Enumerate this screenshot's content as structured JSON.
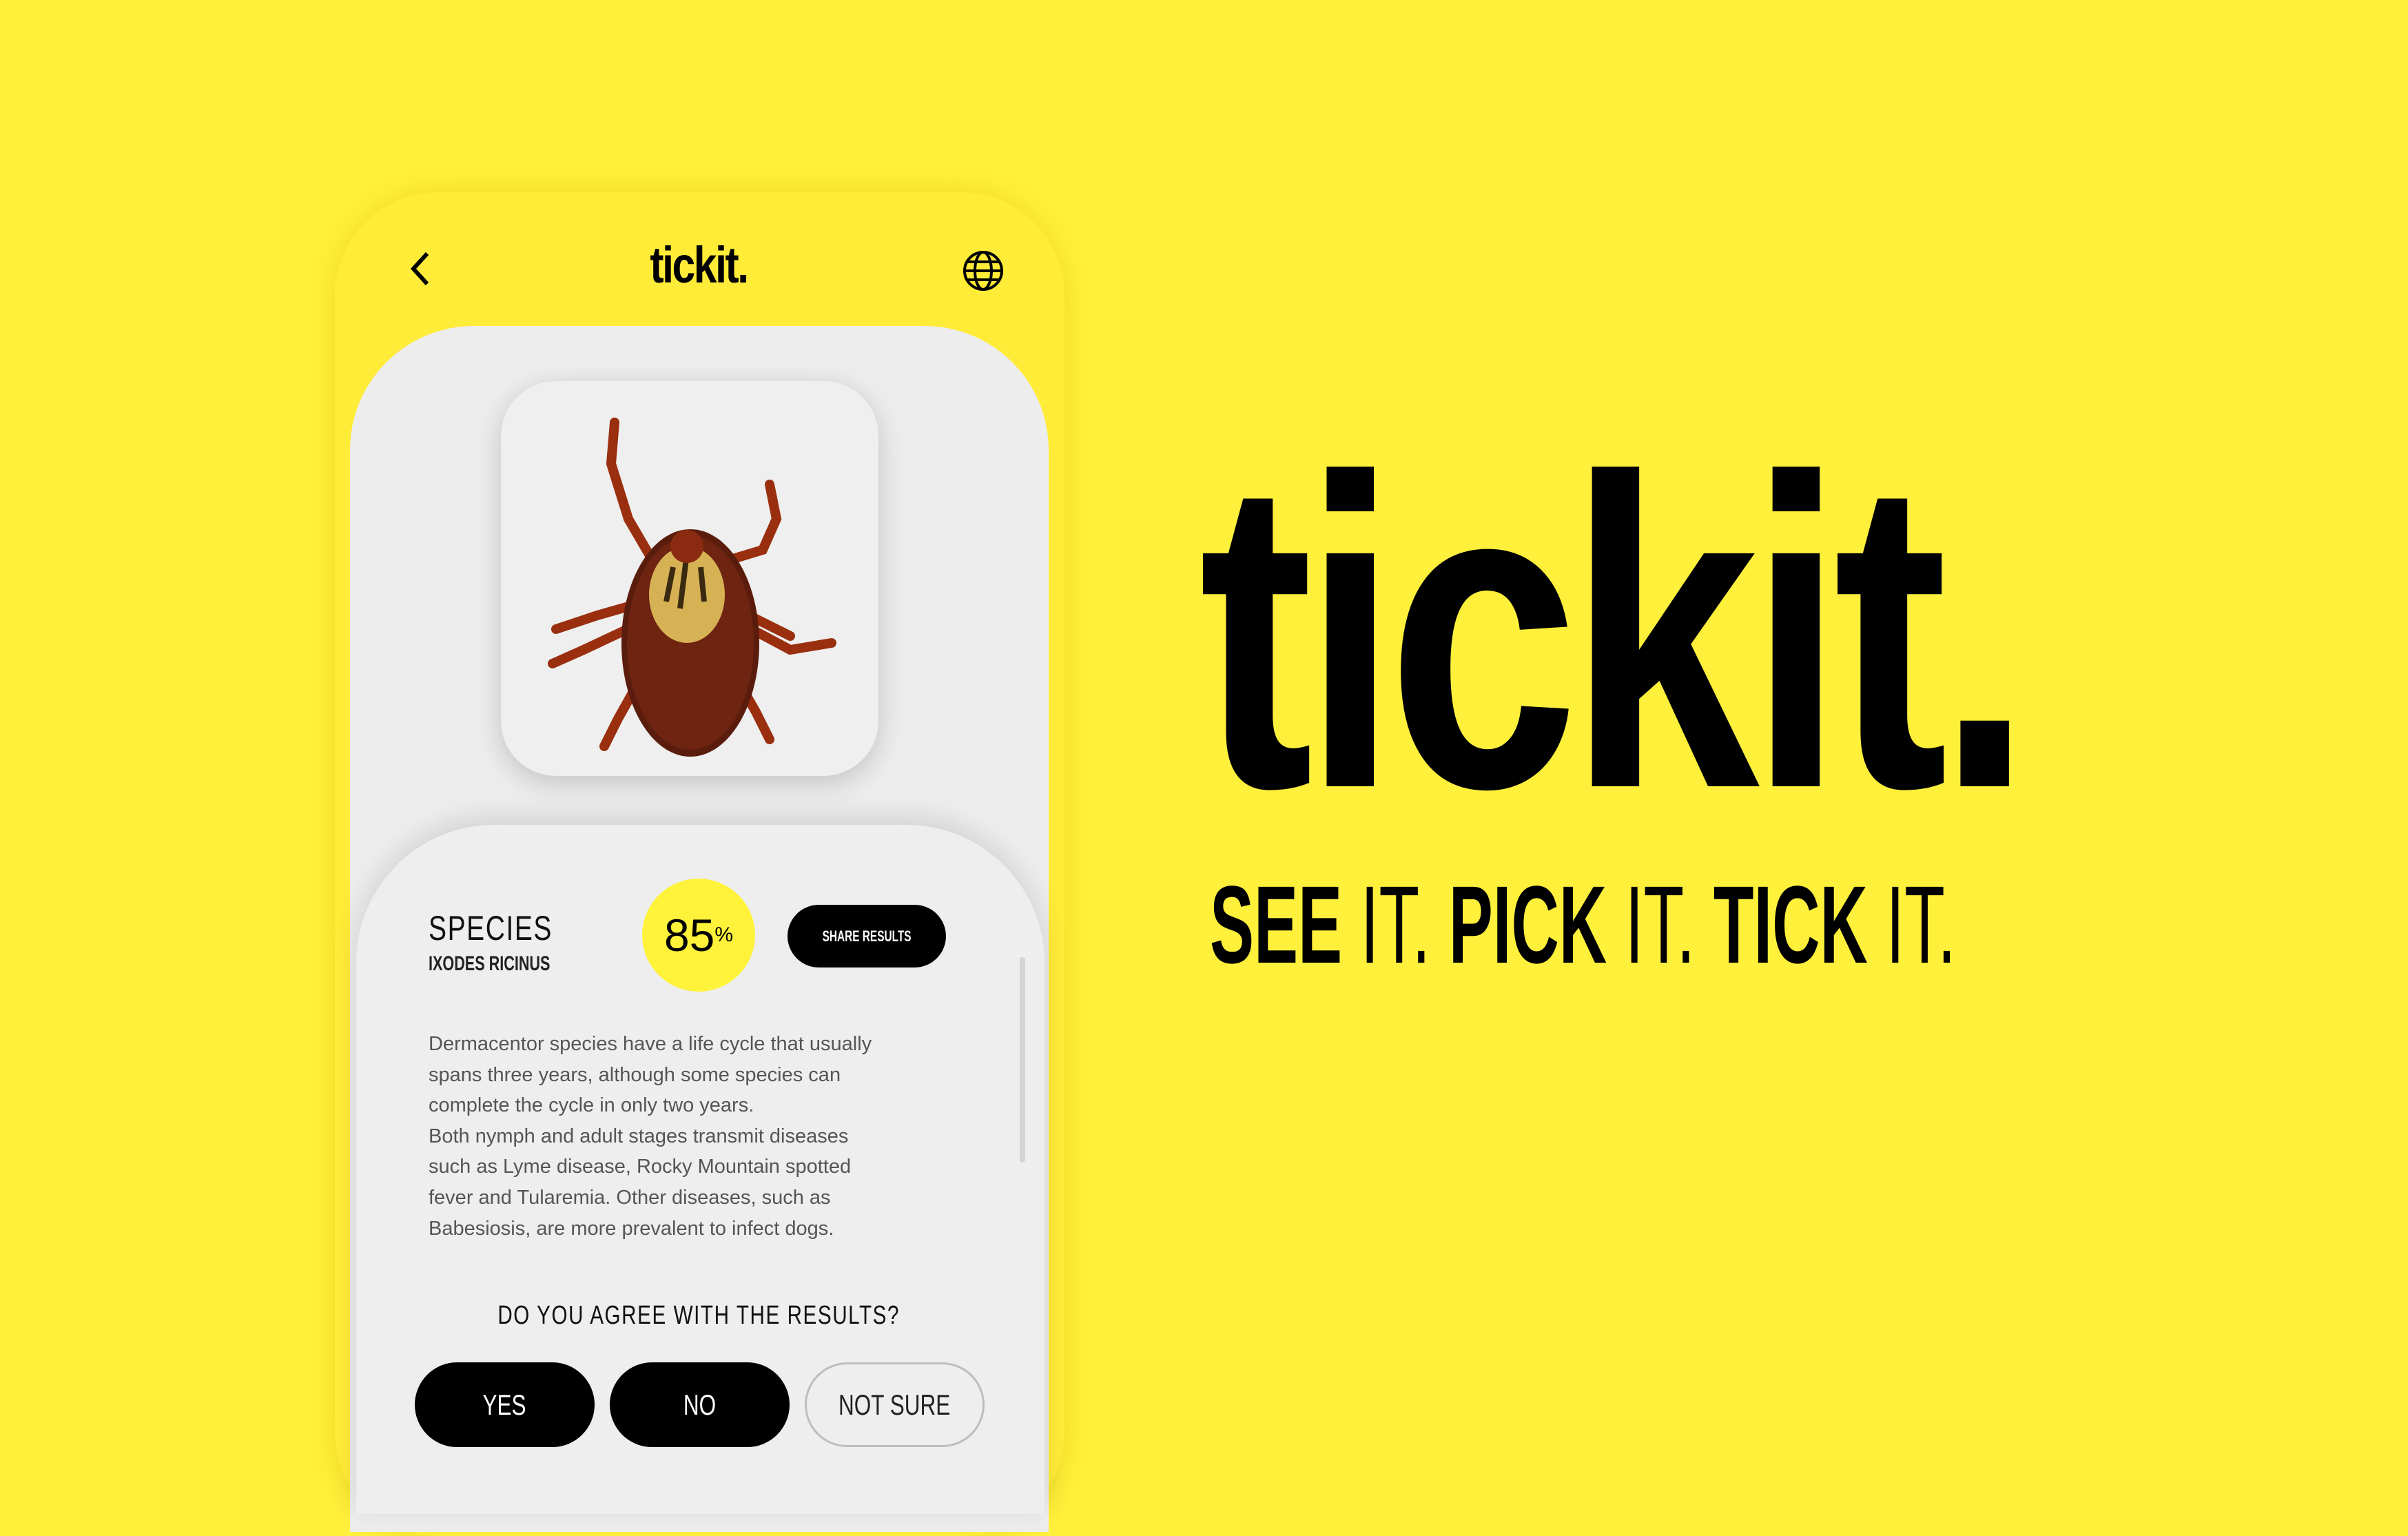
{
  "header": {
    "logo": "tickit.",
    "back_icon": "chevron-left-icon",
    "language_icon": "globe-icon"
  },
  "result": {
    "label": "SPECIES",
    "species_name": "IXODES RICINUS",
    "confidence": "85",
    "confidence_unit": "%",
    "share_label": "SHARE RESULTS"
  },
  "description": [
    "Dermacentor species have a life cycle that usually",
    "spans three years, although some species can",
    "complete the cycle in only two years.",
    "Both nymph and adult stages transmit diseases",
    "such as Lyme disease, Rocky Mountain spotted",
    "fever and Tularemia. Other diseases, such as",
    "Babesiosis, are more prevalent to infect dogs."
  ],
  "feedback": {
    "question": "DO YOU AGREE WITH THE RESULTS?",
    "yes": "YES",
    "no": "NO",
    "not_sure": "NOT SURE"
  },
  "brand": {
    "logo": "tickit.",
    "tagline": [
      {
        "bold": "SEE",
        "normal": " IT. "
      },
      {
        "bold": "PICK",
        "normal": " IT. "
      },
      {
        "bold": "TICK",
        "normal": " IT."
      }
    ]
  },
  "colors": {
    "background": "#fff03c",
    "accent": "#fff23a",
    "dark": "#000000"
  }
}
